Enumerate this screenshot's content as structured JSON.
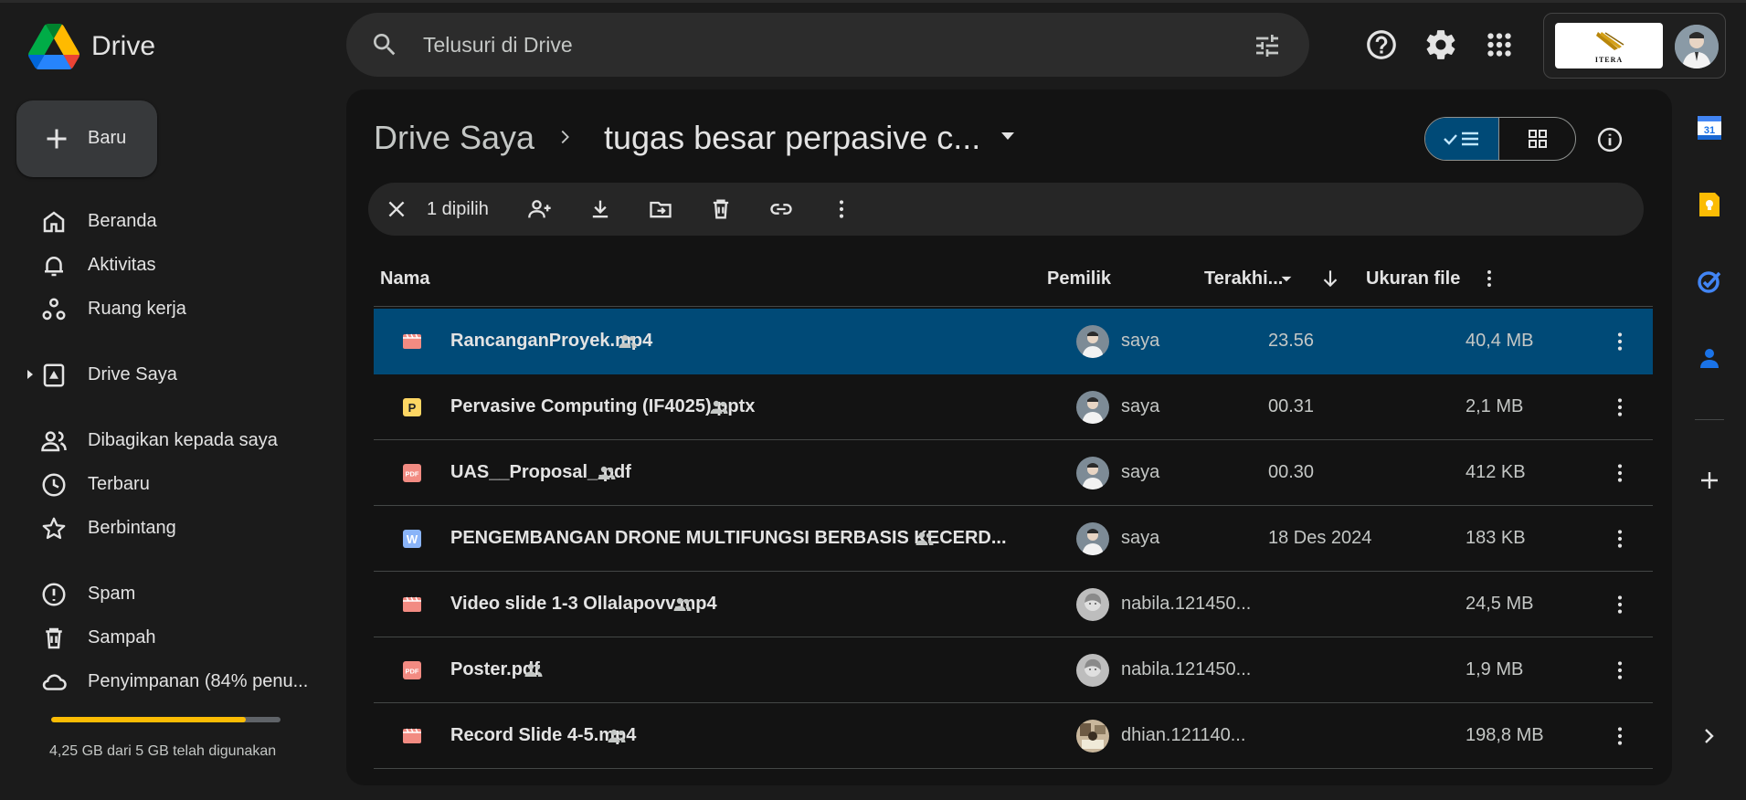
{
  "app": {
    "name": "Drive"
  },
  "search": {
    "placeholder": "Telusuri di Drive"
  },
  "account": {
    "org_label": "ITERA"
  },
  "sidebar": {
    "new_label": "Baru",
    "items": [
      {
        "label": "Beranda",
        "icon": "home-icon"
      },
      {
        "label": "Aktivitas",
        "icon": "bell-icon"
      },
      {
        "label": "Ruang kerja",
        "icon": "workspaces-icon"
      },
      {
        "label": "Drive Saya",
        "icon": "my-drive-icon"
      },
      {
        "label": "Dibagikan kepada saya",
        "icon": "people-icon"
      },
      {
        "label": "Terbaru",
        "icon": "clock-icon"
      },
      {
        "label": "Berbintang",
        "icon": "star-icon"
      },
      {
        "label": "Spam",
        "icon": "spam-icon"
      },
      {
        "label": "Sampah",
        "icon": "trash-icon"
      },
      {
        "label": "Penyimpanan (84% penu...",
        "icon": "cloud-icon"
      }
    ],
    "storage": {
      "used_fraction": 0.85,
      "text": "4,25 GB dari 5 GB telah digunakan"
    }
  },
  "breadcrumb": {
    "root": "Drive Saya",
    "current": "tugas besar perpasive c..."
  },
  "selection": {
    "count_label": "1 dipilih"
  },
  "table": {
    "headers": {
      "name": "Nama",
      "owner": "Pemilik",
      "modified": "Terakhi...",
      "size": "Ukuran file"
    },
    "rows": [
      {
        "name": "RancanganProyek.mp4",
        "type": "video",
        "owner": "saya",
        "modified": "23.56",
        "size": "40,4 MB",
        "selected": true
      },
      {
        "name": "Pervasive Computing (IF4025).pptx",
        "type": "slides",
        "owner": "saya",
        "modified": "00.31",
        "size": "2,1 MB",
        "selected": false
      },
      {
        "name": "UAS__Proposal_.pdf",
        "type": "pdf",
        "owner": "saya",
        "modified": "00.30",
        "size": "412 KB",
        "selected": false
      },
      {
        "name": "PENGEMBANGAN DRONE MULTIFUNGSI BERBASIS KECERD...",
        "type": "doc",
        "owner": "saya",
        "modified": "18 Des 2024",
        "size": "183 KB",
        "selected": false
      },
      {
        "name": "Video slide 1-3 Ollalapovv.mp4",
        "type": "video",
        "owner": "nabila.121450...",
        "modified": "",
        "size": "24,5 MB",
        "selected": false
      },
      {
        "name": "Poster.pdf",
        "type": "pdf",
        "owner": "nabila.121450...",
        "modified": "",
        "size": "1,9 MB",
        "selected": false
      },
      {
        "name": "Record Slide 4-5.mp4",
        "type": "video",
        "owner": "dhian.121140...",
        "modified": "",
        "size": "198,8 MB",
        "selected": false
      }
    ]
  },
  "colors": {
    "accent_selected": "#004a77",
    "storage_fill": "#fbbc04"
  }
}
